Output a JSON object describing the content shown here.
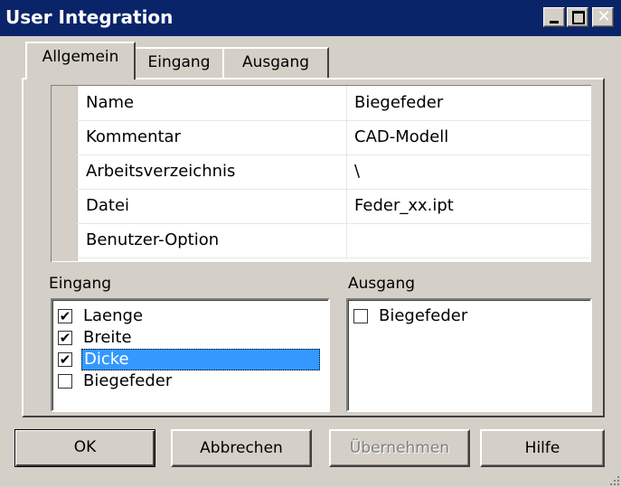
{
  "window": {
    "title": "User Integration",
    "minimize_glyph": "_",
    "maximize_glyph": "□",
    "close_glyph": "✕"
  },
  "tabs": [
    {
      "label": "Allgemein",
      "active": true
    },
    {
      "label": "Eingang",
      "active": false
    },
    {
      "label": "Ausgang",
      "active": false
    }
  ],
  "properties": [
    {
      "key": "Name",
      "value": "Biegefeder"
    },
    {
      "key": "Kommentar",
      "value": "CAD-Modell"
    },
    {
      "key": "Arbeitsverzeichnis",
      "value": "\\"
    },
    {
      "key": "Datei",
      "value": "Feder_xx.ipt"
    },
    {
      "key": "Benutzer-Option",
      "value": ""
    }
  ],
  "eingang": {
    "label": "Eingang",
    "items": [
      {
        "label": "Laenge",
        "checked": true
      },
      {
        "label": "Breite",
        "checked": true
      },
      {
        "label": "Dicke",
        "checked": true,
        "selected": true
      },
      {
        "label": "Biegefeder",
        "checked": false
      }
    ]
  },
  "ausgang": {
    "label": "Ausgang",
    "items": [
      {
        "label": "Biegefeder",
        "checked": false
      }
    ]
  },
  "buttons": {
    "ok": "OK",
    "cancel": "Abbrechen",
    "apply": "Übernehmen",
    "help": "Hilfe"
  },
  "colors": {
    "titlebar": "#0a246a",
    "selection": "#3399ff",
    "face": "#d4d0c8"
  }
}
